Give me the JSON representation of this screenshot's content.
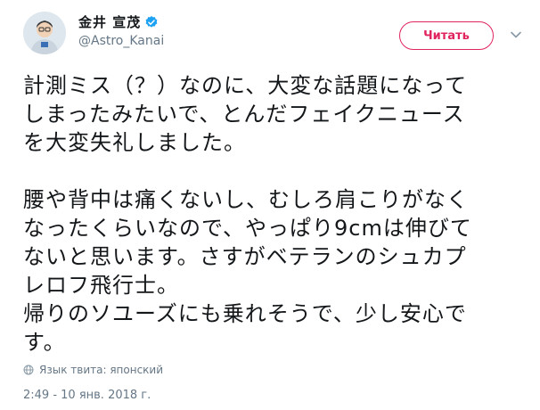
{
  "user": {
    "display_name": "金井 宣茂",
    "handle": "@Astro_Kanai",
    "avatar_icon": "astronaut-avatar",
    "verified_icon": "verified-badge-icon"
  },
  "actions": {
    "follow_label": "Читать",
    "menu_icon": "chevron-down-icon"
  },
  "tweet": {
    "text": "計測ミス（？）なのに、大変な話題になって\nしまったみたいで、とんだフェイクニュース\nを大変失礼しました。\n\n腰や背中は痛くないし、むしろ肩こりがなく\nなったくらいなので、やっぱり9cmは伸びて\nないと思います。さすがベテランのシュカプ\nレロフ飛行士。\n帰りのソユーズにも乗れそうで、少し安心で\nす。",
    "language_label": "Язык твита: японский",
    "timestamp": "2:49 - 10 янв. 2018 г."
  },
  "colors": {
    "accent": "#e0245e",
    "verified": "#1da1f2",
    "secondary_text": "#657786",
    "text": "#14171a"
  }
}
